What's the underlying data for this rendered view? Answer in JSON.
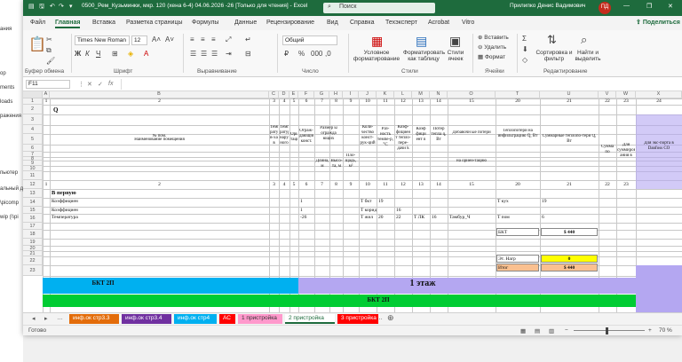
{
  "desktop": {
    "items": [
      "ания",
      "ор",
      "ments",
      "loads",
      "ражения",
      "пьютер",
      "альный д",
      "\\picomp",
      "wip (\\\\pi"
    ]
  },
  "titlebar": {
    "filename": "0500_Рем_Кузьминки, мкр. 120 (хена 6-4) 04.06.2026 -26 [Только для чтения] - Excel",
    "search": "Поиск",
    "user": "Прилипко Денис Вадимович",
    "initials": "ПД"
  },
  "tabs": [
    "Файл",
    "Главная",
    "Вставка",
    "Разметка страницы",
    "Формулы",
    "Данные",
    "Рецензирование",
    "Вид",
    "Справка",
    "Техэксперт",
    "Acrobat",
    "Vitro"
  ],
  "share": "Поделиться",
  "ribbon": {
    "groups": [
      "Буфер обмена",
      "Шрифт",
      "Выравнивание",
      "Число",
      "Стили",
      "Ячейки",
      "Редактирование"
    ],
    "font": "Times New Roman",
    "size": "12",
    "numformat": "Общий",
    "styles": [
      "Условное форматирование",
      "Форматировать как таблицу",
      "Стили ячеек"
    ],
    "cells": [
      "Вставить",
      "Удалить",
      "Формат"
    ],
    "editing": [
      "Сортировка и фильтр",
      "Найти и выделить"
    ]
  },
  "formula": {
    "cell": "F11",
    "fx": "fx"
  },
  "columns": [
    "A",
    "B",
    "C",
    "D",
    "E",
    "F",
    "G",
    "H",
    "I",
    "J",
    "K",
    "L",
    "M",
    "N",
    "O",
    "T",
    "U",
    "V",
    "W",
    "X"
  ],
  "rows": [
    "1",
    "2",
    "3",
    "4",
    "5",
    "6",
    "7",
    "8",
    "9",
    "10",
    "11",
    "12",
    "13",
    "14",
    "15",
    "16",
    "17",
    "18",
    "19",
    "20",
    "21",
    "22",
    "23"
  ],
  "sheet": {
    "row1": [
      "1",
      "2",
      "3",
      "4",
      "5",
      "6",
      "7",
      "8",
      "9",
      "10",
      "11",
      "12",
      "13",
      "14",
      "15",
      "20",
      "21",
      "22",
      "23",
      "24"
    ],
    "q": "Q",
    "headers": {
      "a": "№ пом.",
      "b": "Наименование помещения",
      "c": "Темпе-ратура в-ха в пом., t в, °C",
      "d": "Темпе-ратура наруж-ного в-ха t н",
      "e": "Ориен-тация",
      "f": "Ограж-дающие конст.",
      "g": "Размер ы огражда ющих конструк",
      "g2": "Длина, м",
      "h2": "Высо-та, м",
      "i": "Пло-щадь, м²",
      "j": "Коли-чество конст-рук-ций",
      "k": "Раз-ность темпе-р, °C",
      "l": "Коэф-фициен т тепло-пере-дачи k",
      "m": "Коэф фици ент n",
      "n": "Потер тепла q, Вт",
      "o": "Добавочн ые потери",
      "o2": "на ориен-тацию",
      "t": "Теплопотери на инфильтрацию Q, Вт",
      "u": "Суммарные теплопо-тери Q, Вт",
      "v": "Сумма по квартире",
      "w": "Для суммиров ания в ПЗ",
      "x": "Для экс-порта в Danfoss CO"
    },
    "row5": [
      "1",
      "2",
      "3",
      "4",
      "5",
      "6",
      "7",
      "8",
      "9",
      "10",
      "11",
      "12",
      "13",
      "14",
      "15",
      "20",
      "21",
      "22",
      "23"
    ],
    "r6": {
      "b": "В первую"
    },
    "r7": {
      "b": "Коэффициен",
      "f": "1",
      "j": "T бкт",
      "k": "19",
      "t": "T кух",
      "u": "19"
    },
    "r8": {
      "b": "Коэффициен",
      "f": "1",
      "j": "T корид",
      "l": "16"
    },
    "r9": {
      "b": "Температура",
      "f": "-26",
      "j": "T жил",
      "k": "20",
      "l": "22",
      "m": "T ЛК",
      "n": "16",
      "o": "Тамбур_Ч",
      "t": "T пом",
      "u": "6"
    },
    "summary": [
      {
        "label": "БКТ",
        "value": "$ 440"
      },
      {
        "label": "Эт. Нагр",
        "value": "0"
      },
      {
        "label": "Итог",
        "value": "$ 440"
      }
    ],
    "band1": {
      "left": "БКТ 2П",
      "right": "1 этаж"
    },
    "band2": {
      "text": "БКТ 2П"
    }
  },
  "sheettabs": [
    {
      "label": "инф.ок стр3.3",
      "bg": "#e36c0a",
      "fg": "#fff"
    },
    {
      "label": "инф.ок стр3.4",
      "bg": "#7030a0",
      "fg": "#fff"
    },
    {
      "label": "инф.ок стр4",
      "bg": "#00b0f0",
      "fg": "#fff"
    },
    {
      "label": "АС",
      "bg": "#ff0000",
      "fg": "#fff"
    },
    {
      "label": "1 пристройка",
      "bg": "#ff99cc",
      "fg": "#333"
    },
    {
      "label": "2 пристройка",
      "bg": "#ffffff",
      "fg": "#1e6b3d"
    },
    {
      "label": "3 пристройка",
      "bg": "#ff0000",
      "fg": "#fff"
    }
  ],
  "status": {
    "ready": "Готово",
    "zoom": "70 %"
  },
  "colors": {
    "brand": "#1e6b3d",
    "cyan": "#00b0f0",
    "lavender": "#b4a7f1",
    "green": "#00cc33",
    "orange": "#fac090",
    "yellow": "#ffff00"
  }
}
